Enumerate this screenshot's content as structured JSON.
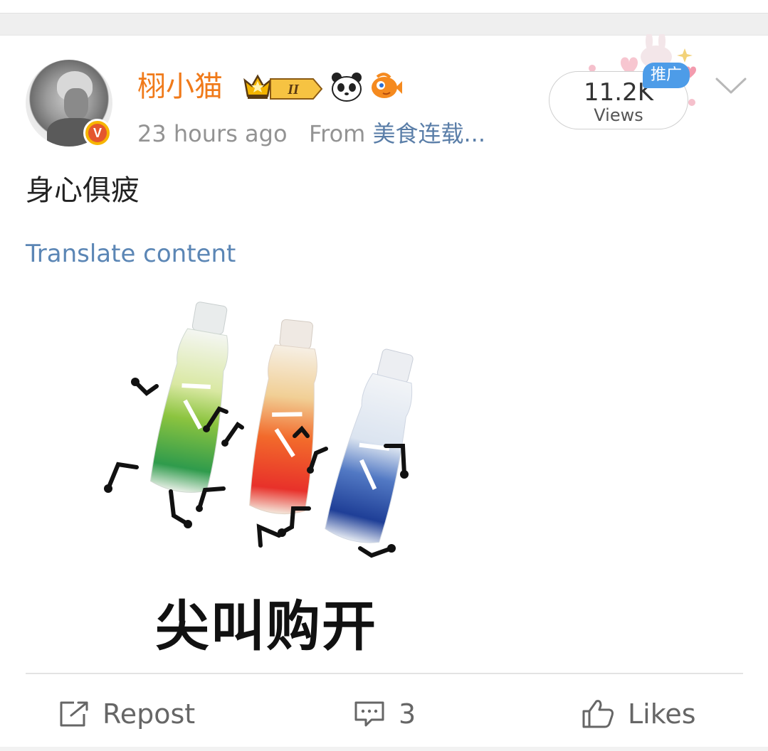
{
  "post": {
    "username": "栩小猫",
    "time": "23 hours ago",
    "from_label": "From",
    "source": "美食连载...",
    "text": "身心俱疲",
    "translate": "Translate content",
    "image_caption": "尖叫购开"
  },
  "views": {
    "count": "11.2K",
    "label": "Views",
    "promo_tag": "推广"
  },
  "badges": {
    "level": "II",
    "verified": "V"
  },
  "actions": {
    "repost": "Repost",
    "comments": "3",
    "likes": "Likes"
  },
  "colors": {
    "username": "#f07a1a",
    "link": "#5b86b5",
    "source": "#5a7ea8",
    "promo": "#4d9ce8",
    "meta": "#939393"
  },
  "icons": [
    "avatar",
    "verified-badge-icon",
    "crown-level-icon",
    "panda-icon",
    "fish-icon",
    "chevron-down-icon",
    "repost-icon",
    "comment-icon",
    "like-icon"
  ]
}
